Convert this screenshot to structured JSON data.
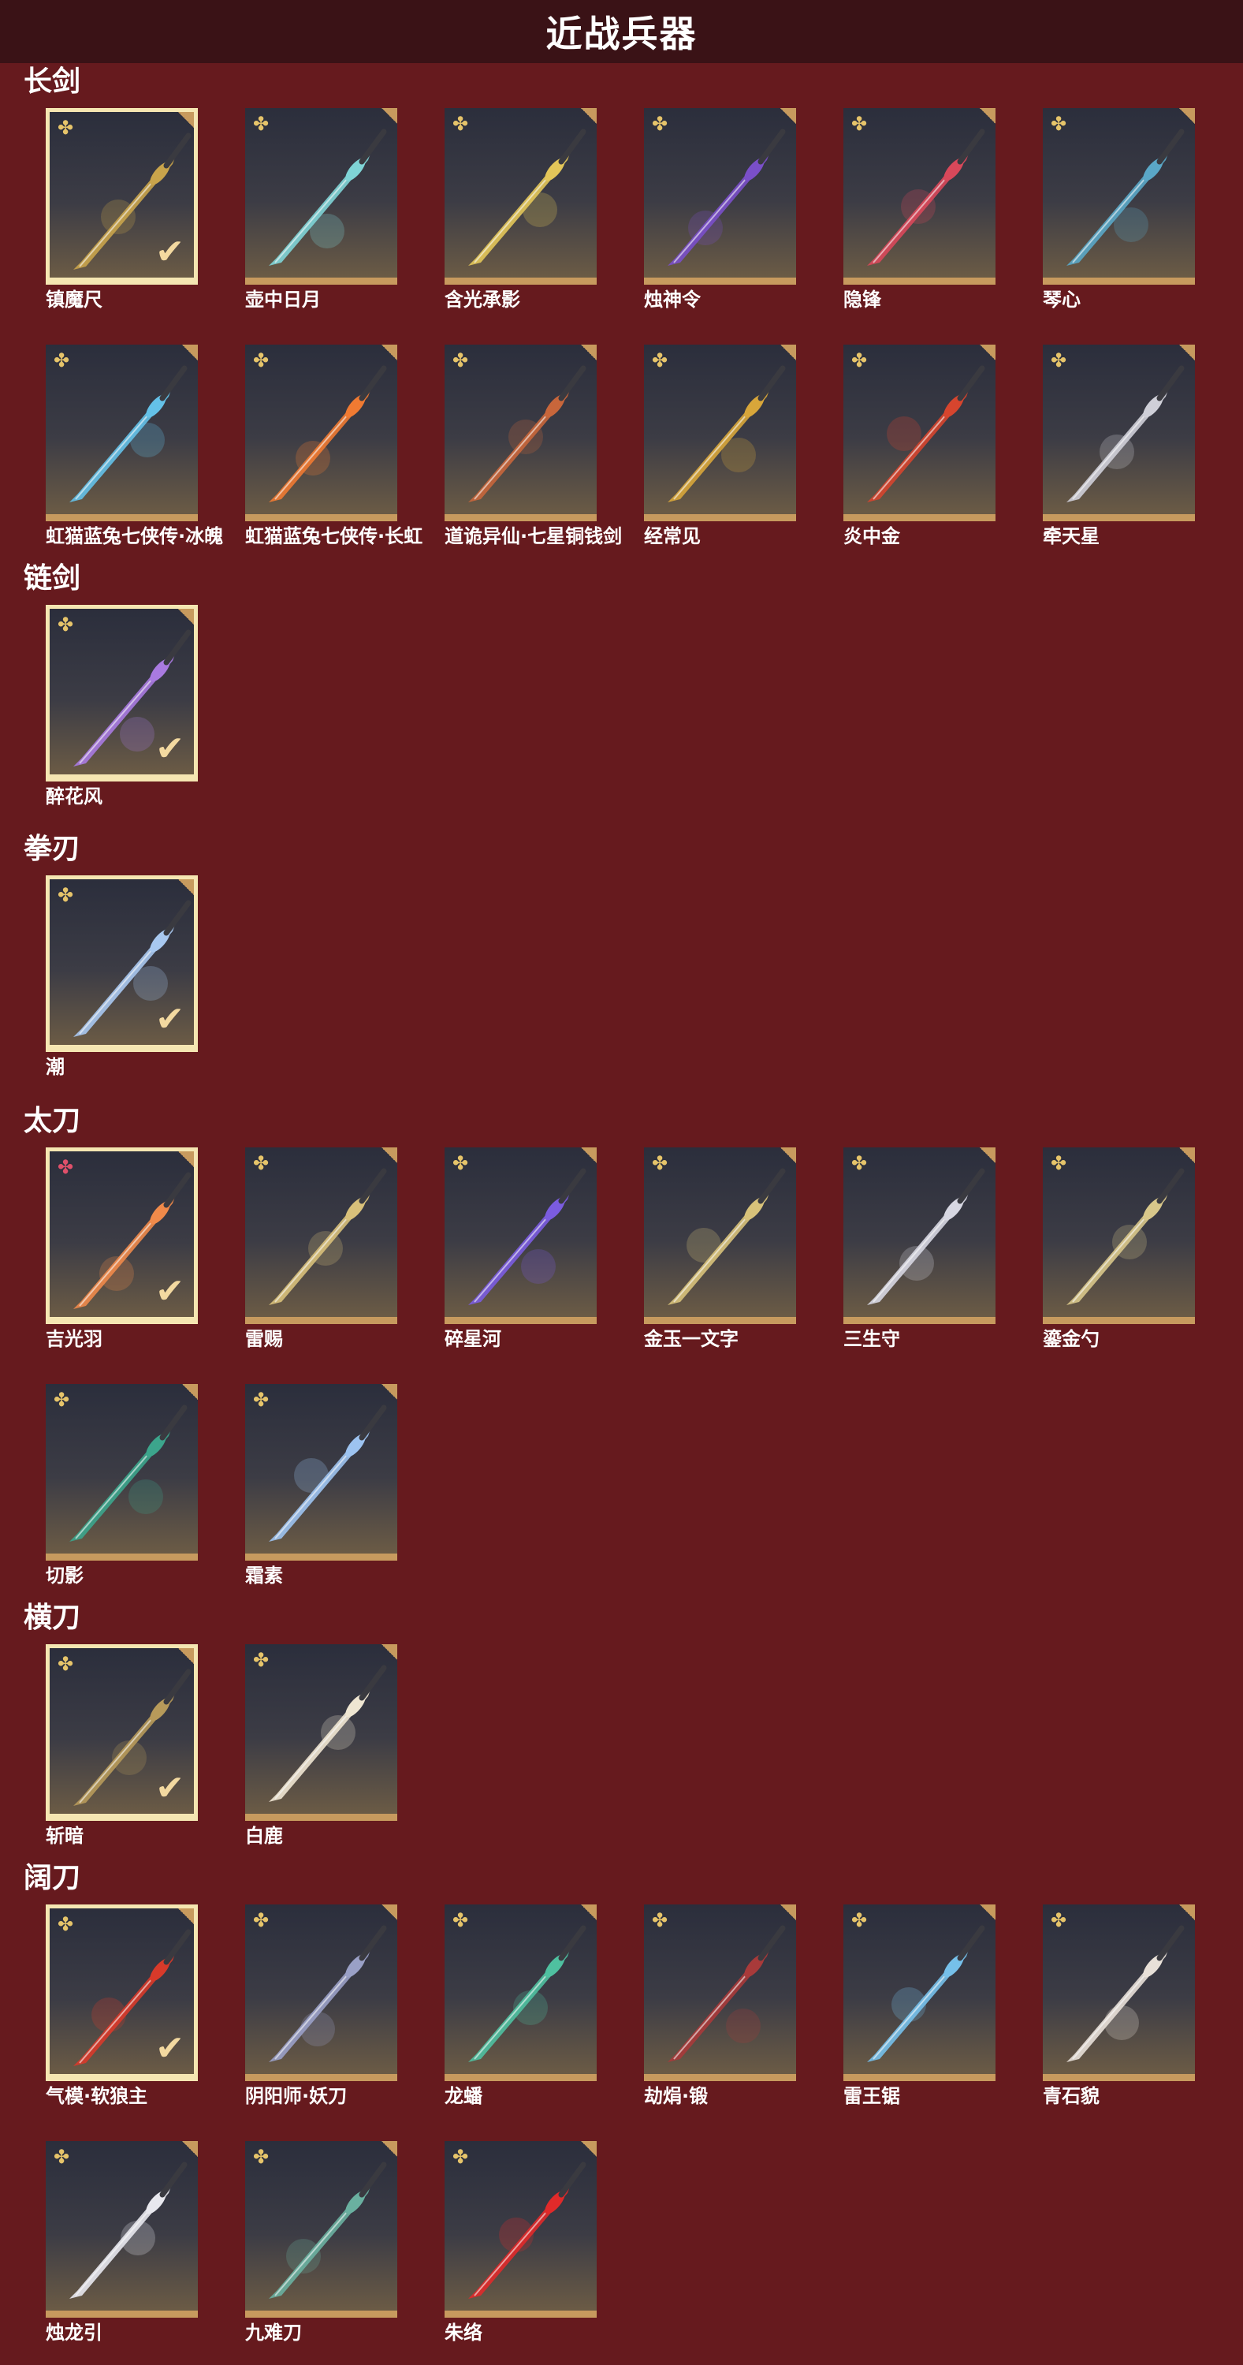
{
  "page_title": "近战兵器",
  "colors": {
    "background": "#661a1e",
    "header": "#3a1216",
    "frame_gold": "#c79a5e",
    "selected_frame": "#f5e6b2"
  },
  "sections": [
    {
      "name": "长剑",
      "items": [
        {
          "label": "镇魔尺",
          "selected": true,
          "accent": "#c9a44b"
        },
        {
          "label": "壶中日月",
          "selected": false,
          "accent": "#7fd4d6"
        },
        {
          "label": "含光承影",
          "selected": false,
          "accent": "#e3c659"
        },
        {
          "label": "烛神令",
          "selected": false,
          "accent": "#7a4fc9"
        },
        {
          "label": "隐锋",
          "selected": false,
          "accent": "#d9485a"
        },
        {
          "label": "琴心",
          "selected": false,
          "accent": "#5aa7c7"
        },
        {
          "label": "虹猫蓝兔七侠传·冰魄",
          "selected": false,
          "accent": "#64c1e8"
        },
        {
          "label": "虹猫蓝兔七侠传·长虹",
          "selected": false,
          "accent": "#f07a32"
        },
        {
          "label": "道诡异仙·七星铜钱剑",
          "selected": false,
          "accent": "#c8663b"
        },
        {
          "label": "经常见",
          "selected": false,
          "accent": "#d8a63a"
        },
        {
          "label": "炎中金",
          "selected": false,
          "accent": "#d6452e"
        },
        {
          "label": "牵天星",
          "selected": false,
          "accent": "#cfcfd8"
        }
      ]
    },
    {
      "name": "链剑",
      "items": [
        {
          "label": "醉花风",
          "selected": true,
          "accent": "#a97ae0"
        }
      ]
    },
    {
      "name": "拳刃",
      "items": [
        {
          "label": "潮",
          "selected": true,
          "accent": "#a8c8f0"
        }
      ]
    },
    {
      "name": "太刀",
      "items": [
        {
          "label": "吉光羽",
          "selected": true,
          "accent": "#f08a4a",
          "rarity": "red"
        },
        {
          "label": "雷赐",
          "selected": false,
          "accent": "#d8c07a"
        },
        {
          "label": "碎星河",
          "selected": false,
          "accent": "#7b5ce0"
        },
        {
          "label": "金玉一文字",
          "selected": false,
          "accent": "#d8c27a"
        },
        {
          "label": "三生守",
          "selected": false,
          "accent": "#d7d7e2"
        },
        {
          "label": "鎏金勺",
          "selected": false,
          "accent": "#d8c78a"
        },
        {
          "label": "切影",
          "selected": false,
          "accent": "#3ca58c"
        },
        {
          "label": "霜素",
          "selected": false,
          "accent": "#9dc3f0"
        }
      ]
    },
    {
      "name": "横刀",
      "items": [
        {
          "label": "斩暗",
          "selected": true,
          "accent": "#b79a5a"
        },
        {
          "label": "白鹿",
          "selected": false,
          "accent": "#efe6d2"
        }
      ]
    },
    {
      "name": "阔刀",
      "items": [
        {
          "label": "气模·软狼主",
          "selected": true,
          "accent": "#d83a2a"
        },
        {
          "label": "阴阳师·妖刀",
          "selected": false,
          "accent": "#9aa0c6"
        },
        {
          "label": "龙蟠",
          "selected": false,
          "accent": "#4fc0a0"
        },
        {
          "label": "劫焆·锻",
          "selected": false,
          "accent": "#a83a3a"
        },
        {
          "label": "雷王锯",
          "selected": false,
          "accent": "#76c0ea"
        },
        {
          "label": "青石貌",
          "selected": false,
          "accent": "#e8e0d8"
        },
        {
          "label": "烛龙引",
          "selected": false,
          "accent": "#e8e8ee"
        },
        {
          "label": "九难刀",
          "selected": false,
          "accent": "#6ab0a0"
        },
        {
          "label": "朱络",
          "selected": false,
          "accent": "#e02a2a"
        }
      ]
    }
  ]
}
